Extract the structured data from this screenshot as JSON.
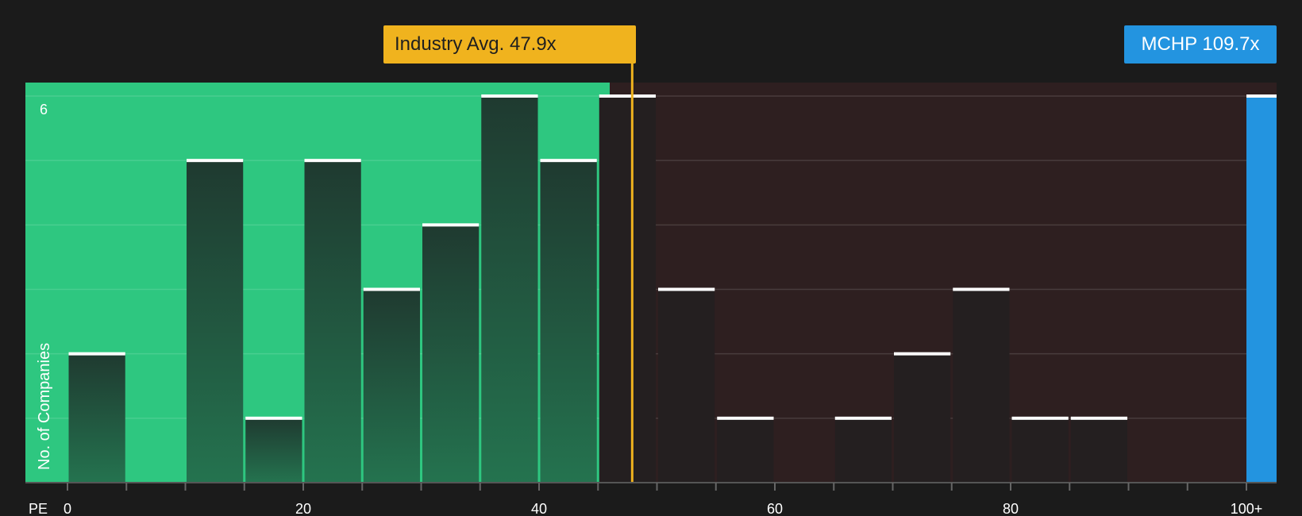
{
  "chart_data": {
    "type": "bar",
    "xlabel": "PE",
    "ylabel": "No. of Companies",
    "xlim": [
      -5,
      105
    ],
    "ylim": [
      0,
      6.2
    ],
    "x_ticks": [
      "0",
      "20",
      "40",
      "60",
      "80",
      "100+"
    ],
    "y_ticks": [
      "6"
    ],
    "grid": true,
    "bin_width": 5,
    "bins": [
      {
        "start": 0,
        "count": 2
      },
      {
        "start": 5,
        "count": 0
      },
      {
        "start": 10,
        "count": 5
      },
      {
        "start": 15,
        "count": 1
      },
      {
        "start": 20,
        "count": 5
      },
      {
        "start": 25,
        "count": 3
      },
      {
        "start": 30,
        "count": 4
      },
      {
        "start": 35,
        "count": 6
      },
      {
        "start": 40,
        "count": 5
      },
      {
        "start": 45,
        "count": 6
      },
      {
        "start": 50,
        "count": 3
      },
      {
        "start": 55,
        "count": 1
      },
      {
        "start": 60,
        "count": 0
      },
      {
        "start": 65,
        "count": 1
      },
      {
        "start": 70,
        "count": 2
      },
      {
        "start": 75,
        "count": 3
      },
      {
        "start": 80,
        "count": 1
      },
      {
        "start": 85,
        "count": 1
      },
      {
        "start": 90,
        "count": 0
      },
      {
        "start": 95,
        "count": 0
      }
    ],
    "subject": {
      "label": "MCHP 109.7x",
      "pe": 109.7,
      "count": 6,
      "color": "#2394e0"
    },
    "industry_avg": {
      "label": "Industry Avg. 47.9x",
      "pe": 47.9,
      "color": "#f0b31e"
    },
    "regions": {
      "below_avg_color": "#2ec780",
      "above_avg_color": "#2e1f20"
    }
  }
}
